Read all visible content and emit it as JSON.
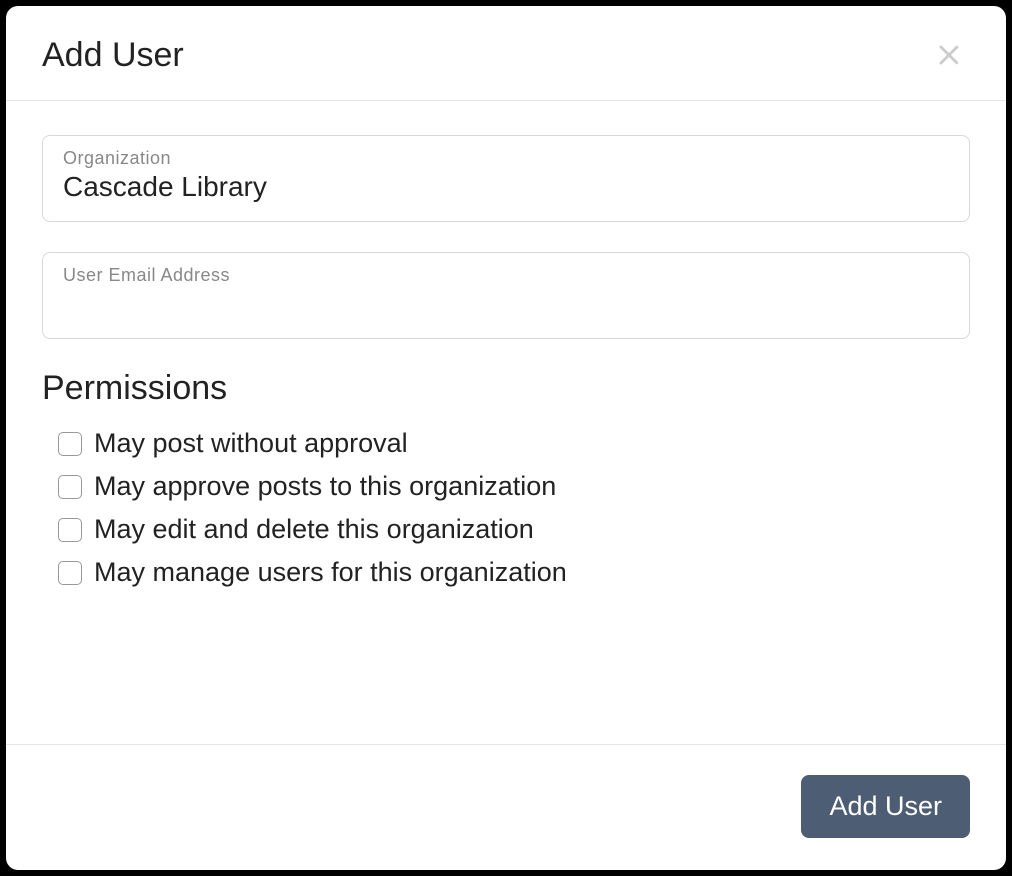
{
  "modal": {
    "title": "Add User"
  },
  "fields": {
    "organization": {
      "label": "Organization",
      "value": "Cascade Library"
    },
    "email": {
      "label": "User Email Address",
      "value": ""
    }
  },
  "permissions": {
    "heading": "Permissions",
    "items": [
      "May post without approval",
      "May approve posts to this organization",
      "May edit and delete this organization",
      "May manage users for this organization"
    ]
  },
  "footer": {
    "submit_label": "Add User"
  }
}
